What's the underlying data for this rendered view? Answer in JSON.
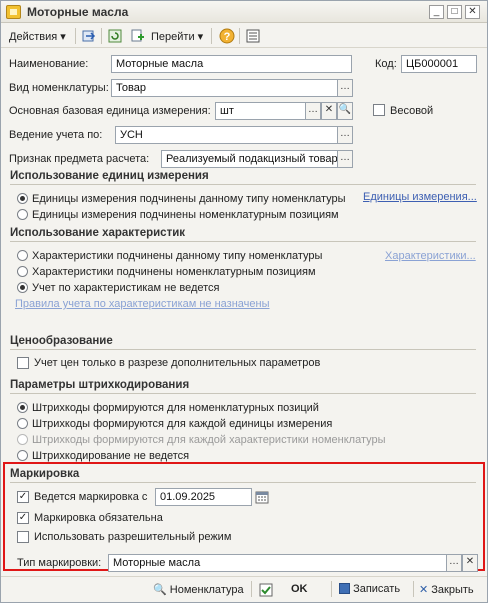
{
  "window": {
    "title": "Моторные масла"
  },
  "toolbar": {
    "actions": "Действия",
    "goto": "Перейти"
  },
  "fields": {
    "name_label": "Наименование:",
    "name_value": "Моторные масла",
    "code_label": "Код:",
    "code_value": "ЦБ000001",
    "type_label": "Вид номенклатуры:",
    "type_value": "Товар",
    "unit_label": "Основная базовая единица измерения:",
    "unit_value": "шт",
    "weight_label": "Весовой",
    "accounting_label": "Ведение учета по:",
    "accounting_value": "УСН",
    "subject_label": "Признак предмета расчета:",
    "subject_value": "Реализуемый подакцизный товар"
  },
  "units_section": {
    "title": "Использование единиц измерения",
    "options": [
      "Единицы измерения подчинены данному типу номенклатуры",
      "Единицы измерения подчинены номенклатурным позициям"
    ],
    "link": "Единицы измерения..."
  },
  "chars_section": {
    "title": "Использование характеристик",
    "options": [
      "Характеристики подчинены данному типу номенклатуры",
      "Характеристики подчинены номенклатурным позициям",
      "Учет по характеристикам не ведется"
    ],
    "link": "Характеристики...",
    "rules_link": "Правила учета по характеристикам не назначены"
  },
  "pricing_section": {
    "title": "Ценообразование",
    "check": "Учет цен только в разрезе дополнительных параметров"
  },
  "barcode_section": {
    "title": "Параметры штрихкодирования",
    "options": [
      "Штрихкоды формируются для номенклатурных позиций",
      "Штрихкоды формируются для каждой единицы измерения",
      "Штрихкоды формируются для каждой характеристики номенклатуры",
      "Штрихкодирование не ведется"
    ]
  },
  "marking_section": {
    "title": "Маркировка",
    "marking_check": "Ведется маркировка с",
    "marking_date": "01.09.2025",
    "mandatory_check": "Маркировка обязательна",
    "permissive_check": "Использовать разрешительный режим",
    "type_label": "Тип маркировки:",
    "type_value": "Моторные масла"
  },
  "bottom": {
    "nomenclature": "Номенклатура",
    "ok": "OK",
    "save": "Записать",
    "close": "Закрыть"
  }
}
